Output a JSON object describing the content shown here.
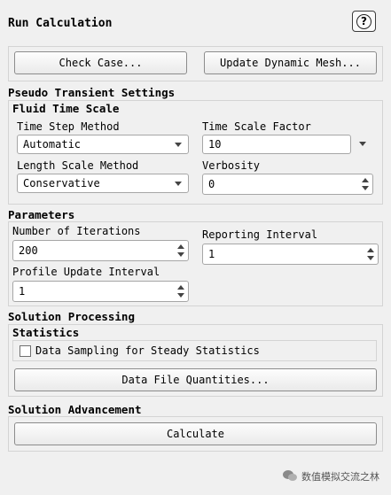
{
  "panel": {
    "title": "Run Calculation"
  },
  "buttons": {
    "check_case": "Check Case...",
    "update_dynamic_mesh": "Update Dynamic Mesh...",
    "data_file_quantities": "Data File Quantities...",
    "calculate": "Calculate"
  },
  "pseudo_transient": {
    "title": "Pseudo Transient Settings",
    "fluid_time_scale": {
      "title": "Fluid Time Scale",
      "time_step_method_label": "Time Step Method",
      "time_step_method_value": "Automatic",
      "time_scale_factor_label": "Time Scale Factor",
      "time_scale_factor_value": "10",
      "length_scale_method_label": "Length Scale Method",
      "length_scale_method_value": "Conservative",
      "verbosity_label": "Verbosity",
      "verbosity_value": "0"
    }
  },
  "parameters": {
    "title": "Parameters",
    "iterations_label": "Number of Iterations",
    "iterations_value": "200",
    "reporting_interval_label": "Reporting Interval",
    "reporting_interval_value": "1",
    "profile_update_label": "Profile Update Interval",
    "profile_update_value": "1"
  },
  "solution_processing": {
    "title": "Solution Processing",
    "statistics_title": "Statistics",
    "data_sampling_label": "Data Sampling for Steady Statistics",
    "data_sampling_checked": false
  },
  "solution_advancement": {
    "title": "Solution Advancement"
  },
  "watermark": {
    "text": "数值模拟交流之林"
  }
}
